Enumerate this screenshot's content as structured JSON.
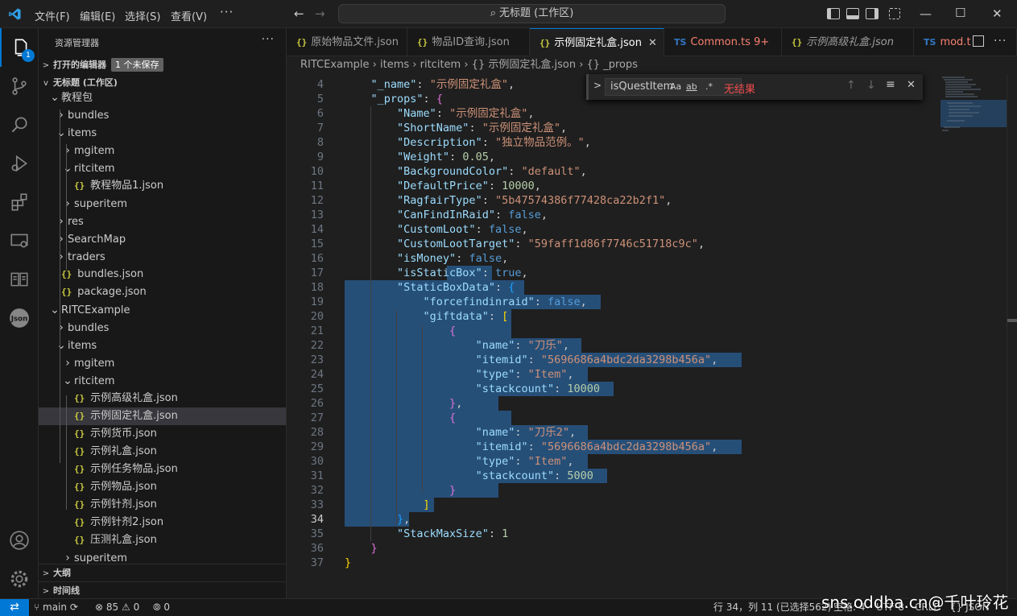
{
  "menus": [
    "文件(F)",
    "编辑(E)",
    "选择(S)",
    "查看(V)"
  ],
  "more": "···",
  "command_center": "无标题 (工作区)",
  "explorer": {
    "title": "资源管理器",
    "open_editors": "打开的编辑器",
    "unsaved": "1 个未保存",
    "workspace": "无标题 (工作区)",
    "outline": "大纲",
    "timeline": "时间线",
    "activity_badge": "1",
    "tree": [
      {
        "label": "教程包",
        "depth": 1,
        "chev": "v",
        "type": "folder"
      },
      {
        "label": "bundles",
        "depth": 2,
        "chev": ">",
        "type": "folder"
      },
      {
        "label": "items",
        "depth": 2,
        "chev": "v",
        "type": "folder"
      },
      {
        "label": "mgitem",
        "depth": 3,
        "chev": ">",
        "type": "folder"
      },
      {
        "label": "ritcitem",
        "depth": 3,
        "chev": "v",
        "type": "folder"
      },
      {
        "label": "教程物品1.json",
        "depth": 4,
        "chev": "",
        "type": "json"
      },
      {
        "label": "superitem",
        "depth": 3,
        "chev": ">",
        "type": "folder"
      },
      {
        "label": "res",
        "depth": 2,
        "chev": ">",
        "type": "folder"
      },
      {
        "label": "SearchMap",
        "depth": 2,
        "chev": ">",
        "type": "folder"
      },
      {
        "label": "traders",
        "depth": 2,
        "chev": ">",
        "type": "folder"
      },
      {
        "label": "bundles.json",
        "depth": 2,
        "chev": "",
        "type": "json"
      },
      {
        "label": "package.json",
        "depth": 2,
        "chev": "",
        "type": "json"
      },
      {
        "label": "RITCExample",
        "depth": 1,
        "chev": "v",
        "type": "folder"
      },
      {
        "label": "bundles",
        "depth": 2,
        "chev": ">",
        "type": "folder"
      },
      {
        "label": "items",
        "depth": 2,
        "chev": "v",
        "type": "folder"
      },
      {
        "label": "mgitem",
        "depth": 3,
        "chev": ">",
        "type": "folder"
      },
      {
        "label": "ritcitem",
        "depth": 3,
        "chev": "v",
        "type": "folder"
      },
      {
        "label": "示例高级礼盒.json",
        "depth": 4,
        "chev": "",
        "type": "json"
      },
      {
        "label": "示例固定礼盒.json",
        "depth": 4,
        "chev": "",
        "type": "json",
        "selected": true
      },
      {
        "label": "示例货币.json",
        "depth": 4,
        "chev": "",
        "type": "json"
      },
      {
        "label": "示例礼盒.json",
        "depth": 4,
        "chev": "",
        "type": "json"
      },
      {
        "label": "示例任务物品.json",
        "depth": 4,
        "chev": "",
        "type": "json"
      },
      {
        "label": "示例物品.json",
        "depth": 4,
        "chev": "",
        "type": "json"
      },
      {
        "label": "示例针剂.json",
        "depth": 4,
        "chev": "",
        "type": "json"
      },
      {
        "label": "示例针剂2.json",
        "depth": 4,
        "chev": "",
        "type": "json"
      },
      {
        "label": "压测礼盒.json",
        "depth": 4,
        "chev": "",
        "type": "json"
      },
      {
        "label": "superitem",
        "depth": 3,
        "chev": ">",
        "type": "folder"
      }
    ]
  },
  "tabs": [
    {
      "label": "原始物品文件.json",
      "kind": "json"
    },
    {
      "label": "物品ID查询.json",
      "kind": "json"
    },
    {
      "label": "示例固定礼盒.json",
      "kind": "json",
      "active": true
    },
    {
      "label": "Common.ts 9+",
      "kind": "ts",
      "error": true
    },
    {
      "label": "示例高级礼盒.json",
      "kind": "json"
    },
    {
      "label": "mod.t",
      "kind": "ts",
      "error": true
    }
  ],
  "breadcrumb": [
    "RITCExample",
    "items",
    "ritcitem",
    "{} 示例固定礼盒.json",
    "{} _props"
  ],
  "find": {
    "value": "isQuestItem",
    "result": "无结果",
    "opt_case": "Aa",
    "opt_word": "ab",
    "opt_regex": ".*"
  },
  "code": [
    {
      "n": "4",
      "t": [
        [
          "p",
          "    "
        ],
        [
          "k",
          "\"_name\""
        ],
        [
          "p",
          ": "
        ],
        [
          "s",
          "\"示例固定礼盒\""
        ],
        [
          "p",
          ","
        ]
      ]
    },
    {
      "n": "5",
      "t": [
        [
          "p",
          "    "
        ],
        [
          "k",
          "\"_props\""
        ],
        [
          "p",
          ": "
        ],
        [
          "br2",
          "{"
        ]
      ]
    },
    {
      "n": "6",
      "t": [
        [
          "p",
          "        "
        ],
        [
          "k",
          "\"Name\""
        ],
        [
          "p",
          ": "
        ],
        [
          "s",
          "\"示例固定礼盒\""
        ],
        [
          "p",
          ","
        ]
      ]
    },
    {
      "n": "7",
      "t": [
        [
          "p",
          "        "
        ],
        [
          "k",
          "\"ShortName\""
        ],
        [
          "p",
          ": "
        ],
        [
          "s",
          "\"示例固定礼盒\""
        ],
        [
          "p",
          ","
        ]
      ]
    },
    {
      "n": "8",
      "t": [
        [
          "p",
          "        "
        ],
        [
          "k",
          "\"Description\""
        ],
        [
          "p",
          ": "
        ],
        [
          "s",
          "\"独立物品范例。\""
        ],
        [
          "p",
          ","
        ]
      ]
    },
    {
      "n": "9",
      "t": [
        [
          "p",
          "        "
        ],
        [
          "k",
          "\"Weight\""
        ],
        [
          "p",
          ": "
        ],
        [
          "n",
          "0.05"
        ],
        [
          "p",
          ","
        ]
      ]
    },
    {
      "n": "10",
      "t": [
        [
          "p",
          "        "
        ],
        [
          "k",
          "\"BackgroundColor\""
        ],
        [
          "p",
          ": "
        ],
        [
          "s",
          "\"default\""
        ],
        [
          "p",
          ","
        ]
      ]
    },
    {
      "n": "11",
      "t": [
        [
          "p",
          "        "
        ],
        [
          "k",
          "\"DefaultPrice\""
        ],
        [
          "p",
          ": "
        ],
        [
          "n",
          "10000"
        ],
        [
          "p",
          ","
        ]
      ]
    },
    {
      "n": "12",
      "t": [
        [
          "p",
          "        "
        ],
        [
          "k",
          "\"RagfairType\""
        ],
        [
          "p",
          ": "
        ],
        [
          "s",
          "\"5b47574386f77428ca22b2f1\""
        ],
        [
          "p",
          ","
        ]
      ]
    },
    {
      "n": "13",
      "t": [
        [
          "p",
          "        "
        ],
        [
          "k",
          "\"CanFindInRaid\""
        ],
        [
          "p",
          ": "
        ],
        [
          "b",
          "false"
        ],
        [
          "p",
          ","
        ]
      ]
    },
    {
      "n": "14",
      "t": [
        [
          "p",
          "        "
        ],
        [
          "k",
          "\"CustomLoot\""
        ],
        [
          "p",
          ": "
        ],
        [
          "b",
          "false"
        ],
        [
          "p",
          ","
        ]
      ]
    },
    {
      "n": "15",
      "t": [
        [
          "p",
          "        "
        ],
        [
          "k",
          "\"CustomLootTarget\""
        ],
        [
          "p",
          ": "
        ],
        [
          "s",
          "\"59faff1d86f7746c51718c9c\""
        ],
        [
          "p",
          ","
        ]
      ]
    },
    {
      "n": "16",
      "t": [
        [
          "p",
          "        "
        ],
        [
          "k",
          "\"isMoney\""
        ],
        [
          "p",
          ": "
        ],
        [
          "b",
          "false"
        ],
        [
          "p",
          ","
        ]
      ]
    },
    {
      "n": "17",
      "t": [
        [
          "p",
          "        "
        ],
        [
          "k",
          "\"isStaticBox\""
        ],
        [
          "p",
          ": "
        ],
        [
          "b",
          "true"
        ],
        [
          "p",
          ","
        ]
      ]
    },
    {
      "n": "18",
      "t": [
        [
          "p",
          "        "
        ],
        [
          "k",
          "\"StaticBoxData\""
        ],
        [
          "p",
          ": "
        ],
        [
          "br3",
          "{"
        ]
      ]
    },
    {
      "n": "19",
      "t": [
        [
          "p",
          "            "
        ],
        [
          "k",
          "\"forcefindinraid\""
        ],
        [
          "p",
          ": "
        ],
        [
          "b",
          "false"
        ],
        [
          "p",
          ","
        ]
      ]
    },
    {
      "n": "20",
      "t": [
        [
          "p",
          "            "
        ],
        [
          "k",
          "\"giftdata\""
        ],
        [
          "p",
          ": "
        ],
        [
          "br1",
          "["
        ]
      ]
    },
    {
      "n": "21",
      "t": [
        [
          "p",
          "                "
        ],
        [
          "br2",
          "{"
        ]
      ]
    },
    {
      "n": "22",
      "t": [
        [
          "p",
          "                    "
        ],
        [
          "k",
          "\"name\""
        ],
        [
          "p",
          ": "
        ],
        [
          "s",
          "\"刀乐\""
        ],
        [
          "p",
          ","
        ]
      ]
    },
    {
      "n": "23",
      "t": [
        [
          "p",
          "                    "
        ],
        [
          "k",
          "\"itemid\""
        ],
        [
          "p",
          ": "
        ],
        [
          "s",
          "\"5696686a4bdc2da3298b456a\""
        ],
        [
          "p",
          ","
        ]
      ]
    },
    {
      "n": "24",
      "t": [
        [
          "p",
          "                    "
        ],
        [
          "k",
          "\"type\""
        ],
        [
          "p",
          ": "
        ],
        [
          "s",
          "\"Item\""
        ],
        [
          "p",
          ","
        ]
      ]
    },
    {
      "n": "25",
      "t": [
        [
          "p",
          "                    "
        ],
        [
          "k",
          "\"stackcount\""
        ],
        [
          "p",
          ": "
        ],
        [
          "n",
          "10000"
        ]
      ]
    },
    {
      "n": "26",
      "t": [
        [
          "p",
          "                "
        ],
        [
          "br2",
          "}"
        ],
        [
          "p",
          ","
        ]
      ]
    },
    {
      "n": "27",
      "t": [
        [
          "p",
          "                "
        ],
        [
          "br2",
          "{"
        ]
      ]
    },
    {
      "n": "28",
      "t": [
        [
          "p",
          "                    "
        ],
        [
          "k",
          "\"name\""
        ],
        [
          "p",
          ": "
        ],
        [
          "s",
          "\"刀乐2\""
        ],
        [
          "p",
          ","
        ]
      ]
    },
    {
      "n": "29",
      "t": [
        [
          "p",
          "                    "
        ],
        [
          "k",
          "\"itemid\""
        ],
        [
          "p",
          ": "
        ],
        [
          "s",
          "\"5696686a4bdc2da3298b456a\""
        ],
        [
          "p",
          ","
        ]
      ]
    },
    {
      "n": "30",
      "t": [
        [
          "p",
          "                    "
        ],
        [
          "k",
          "\"type\""
        ],
        [
          "p",
          ": "
        ],
        [
          "s",
          "\"Item\""
        ],
        [
          "p",
          ","
        ]
      ]
    },
    {
      "n": "31",
      "t": [
        [
          "p",
          "                    "
        ],
        [
          "k",
          "\"stackcount\""
        ],
        [
          "p",
          ": "
        ],
        [
          "n",
          "5000"
        ]
      ]
    },
    {
      "n": "32",
      "t": [
        [
          "p",
          "                "
        ],
        [
          "br2",
          "}"
        ]
      ]
    },
    {
      "n": "33",
      "t": [
        [
          "p",
          "            "
        ],
        [
          "br1",
          "]"
        ]
      ]
    },
    {
      "n": "34",
      "t": [
        [
          "p",
          "        "
        ],
        [
          "br3",
          "}"
        ],
        [
          "p",
          ","
        ]
      ]
    },
    {
      "n": "35",
      "t": [
        [
          "p",
          "        "
        ],
        [
          "k",
          "\"StackMaxSize\""
        ],
        [
          "p",
          ": "
        ],
        [
          "n",
          "1"
        ]
      ]
    },
    {
      "n": "36",
      "t": [
        [
          "p",
          "    "
        ],
        [
          "br2",
          "}"
        ]
      ]
    },
    {
      "n": "37",
      "t": [
        [
          "br1",
          "}"
        ]
      ]
    }
  ],
  "cursor_line": "34",
  "status": {
    "branch": "main",
    "errors": "85",
    "warnings": "0",
    "ports": "0",
    "position": "行 34，列 11 (已选择562)",
    "spaces": "空格: 4",
    "encoding": "UTF-8",
    "eol": "CRLF",
    "language": "{} JSON"
  },
  "watermark": "sns.oddba.cn@千叶玲花",
  "colors": {
    "accent": "#0078d4",
    "selection": "#264f78",
    "string": "#ce9178",
    "key": "#9cdcfe",
    "number": "#b5cea8",
    "keyword": "#569cd6"
  }
}
